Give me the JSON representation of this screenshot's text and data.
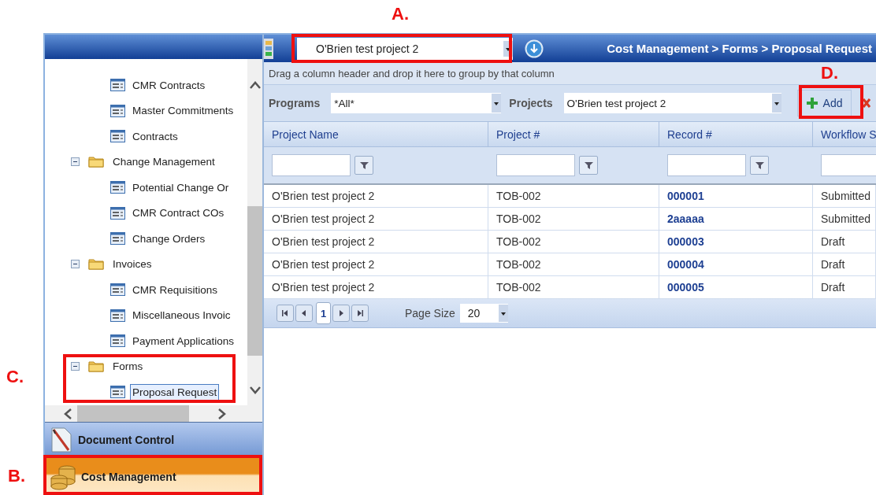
{
  "header": {
    "project_select": {
      "value": "O'Brien test project 2"
    },
    "breadcrumb": "Cost Management > Forms > Proposal Request"
  },
  "tree": [
    {
      "children": [
        {
          "label": "CMR Contracts",
          "selected": false
        },
        {
          "label": "Master Commitments",
          "selected": false
        },
        {
          "label": "Contracts",
          "selected": false
        }
      ]
    },
    {
      "label": "Change Management",
      "expanded": true,
      "children": [
        {
          "label": "Potential Change Or",
          "selected": false
        },
        {
          "label": "CMR Contract COs",
          "selected": false
        },
        {
          "label": "Change Orders",
          "selected": false
        }
      ]
    },
    {
      "label": "Invoices",
      "expanded": true,
      "children": [
        {
          "label": "CMR Requisitions",
          "selected": false
        },
        {
          "label": "Miscellaneous Invoic",
          "selected": false
        },
        {
          "label": "Payment Applications",
          "selected": false
        }
      ]
    },
    {
      "label": "Forms",
      "expanded": true,
      "children": [
        {
          "label": "Proposal Request",
          "selected": true
        }
      ]
    }
  ],
  "nav_sections": [
    {
      "label": "Document Control",
      "selected": false
    },
    {
      "label": "Cost Management",
      "selected": true
    }
  ],
  "group_hint": "Drag a column header and drop it here to group by that column",
  "filters": [
    {
      "label": "Programs",
      "value": "*All*"
    },
    {
      "label": "Projects",
      "value": "O'Brien test project 2"
    }
  ],
  "toolbar_buttons": [
    {
      "kind": "add",
      "label": "Add"
    },
    {
      "kind": "delete"
    }
  ],
  "table": {
    "columns": [
      {
        "label": "Project Name",
        "kind": "text",
        "filter_button": true
      },
      {
        "label": "Project #",
        "kind": "text",
        "filter_button": true
      },
      {
        "label": "Record #",
        "kind": "link",
        "filter_button": true
      },
      {
        "label": "Workflow S",
        "kind": "text"
      }
    ],
    "rows": [
      [
        "O'Brien test project 2",
        "TOB-002",
        "000001",
        "Submitted"
      ],
      [
        "O'Brien test project 2",
        "TOB-002",
        "2aaaaa",
        "Submitted"
      ],
      [
        "O'Brien test project 2",
        "TOB-002",
        "000003",
        "Draft"
      ],
      [
        "O'Brien test project 2",
        "TOB-002",
        "000004",
        "Draft"
      ],
      [
        "O'Brien test project 2",
        "TOB-002",
        "000005",
        "Draft"
      ]
    ]
  },
  "pager": {
    "page": "1",
    "page_size_label": "Page Size",
    "page_size": "20"
  },
  "annotations": [
    {
      "label": "A."
    },
    {
      "label": "B."
    },
    {
      "label": "C."
    },
    {
      "label": "D."
    }
  ]
}
